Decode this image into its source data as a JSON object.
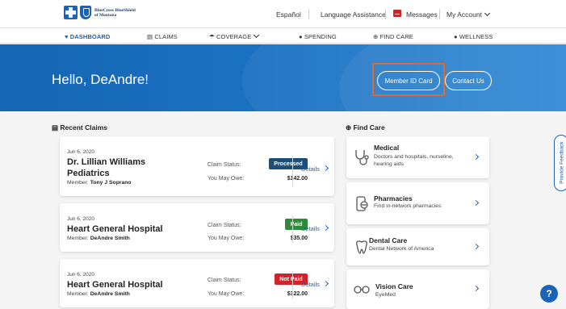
{
  "brand": {
    "name_line1": "BlueCross BlueShield",
    "name_line2": "of Montana"
  },
  "utility": {
    "espanol": "Español",
    "language": "Language Assistance",
    "messages": "Messages",
    "account": "My Account"
  },
  "nav": {
    "dashboard": "DASHBOARD",
    "claims": "CLAIMS",
    "coverage": "COVERAGE",
    "spending": "SPENDING",
    "findcare": "FIND CARE",
    "wellness": "WELLNESS"
  },
  "hero": {
    "greeting": "Hello, DeAndre!",
    "member_id": "Member ID Card",
    "contact": "Contact Us"
  },
  "claims": {
    "title": "Recent Claims",
    "status_label": "Claim Status:",
    "owe_label": "You May Owe:",
    "details": "Details",
    "items": [
      {
        "date": "Jun 6, 2020",
        "name_l1": "Dr. Lillian Williams",
        "name_l2": "Pediatrics",
        "member_label": "Member:",
        "member": "Tony J Soprano",
        "status": "Processed",
        "owe": "$142.00"
      },
      {
        "date": "Jun 6, 2020",
        "name_l1": "Heart General Hospital",
        "member_label": "Member:",
        "member": "DeAndre Smith",
        "status": "Paid",
        "owe": "$35.00"
      },
      {
        "date": "Jun 6, 2020",
        "name_l1": "Heart General Hospital",
        "member_label": "Member:",
        "member": "DeAndre Smith",
        "status": "Not Paid",
        "owe": "$322.00"
      }
    ]
  },
  "findcare": {
    "title": "Find Care",
    "items": [
      {
        "title": "Medical",
        "desc_l1": "Doctors and hospitals, nurseline,",
        "desc_l2": "hearing aids"
      },
      {
        "title": "Pharmacies",
        "desc_l1": "Find in-network pharmacies"
      },
      {
        "title": "Dental Care",
        "desc_l1": "Dental Network of America"
      },
      {
        "title": "Vision Care",
        "desc_l1": "EyeMed"
      }
    ]
  },
  "feedback": "Provide Feedback",
  "help": "?",
  "colors": {
    "brand": "#1a63b8",
    "processed": "#1b4f7a",
    "paid": "#2e8b3a",
    "notpaid": "#d3222a",
    "highlight": "#e4682a"
  }
}
